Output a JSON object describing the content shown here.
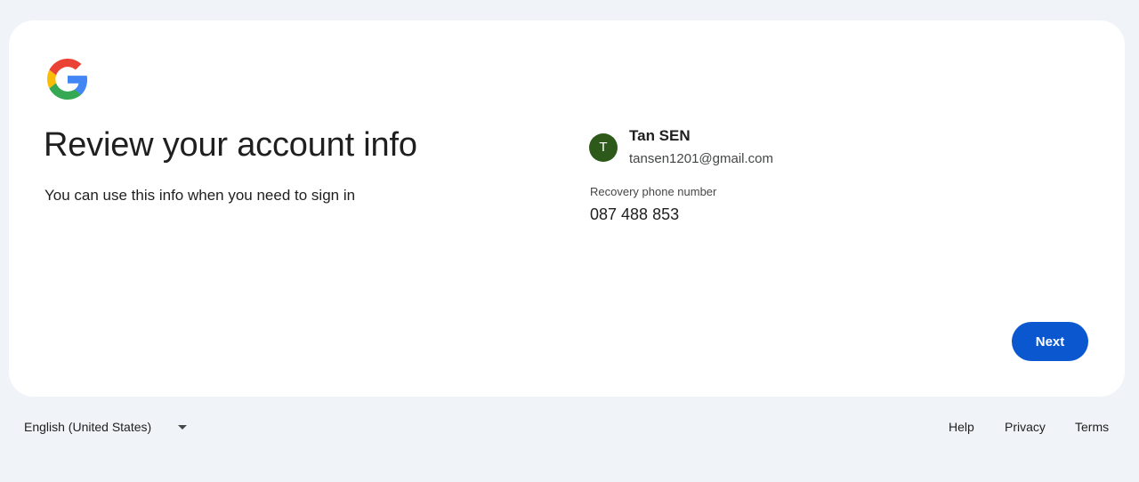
{
  "logo": {
    "icon": "google-g-icon",
    "colors": [
      "#4285f4",
      "#ea4335",
      "#fbbc05",
      "#34a853"
    ]
  },
  "header": {
    "title": "Review your account info",
    "subtitle": "You can use this info when you need to sign in"
  },
  "account": {
    "avatar_initial": "T",
    "avatar_color": "#2d5a1b",
    "name": "Tan SEN",
    "email": "tansen1201@gmail.com"
  },
  "recovery": {
    "label": "Recovery phone number",
    "value": "087 488 853"
  },
  "actions": {
    "next_label": "Next",
    "accent_color": "#0b57d0"
  },
  "footer": {
    "language": "English (United States)",
    "links": {
      "help": "Help",
      "privacy": "Privacy",
      "terms": "Terms"
    }
  }
}
